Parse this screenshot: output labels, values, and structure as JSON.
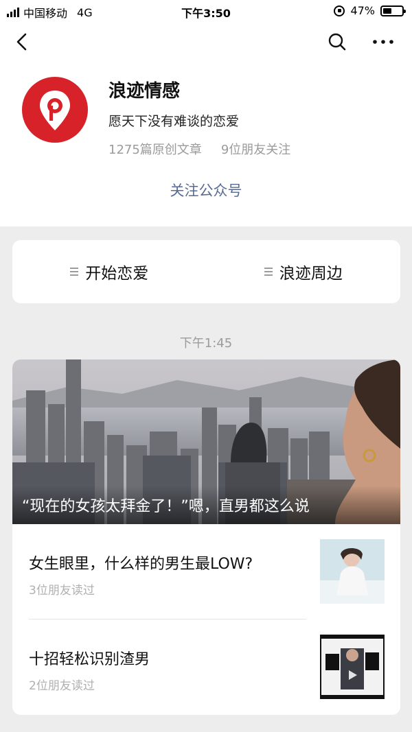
{
  "status_bar": {
    "carrier": "中国移动",
    "network": "4G",
    "time": "下午3:50",
    "battery_pct": "47%",
    "battery_level": 0.47
  },
  "nav": {
    "back_icon": "chevron-left-icon",
    "search_icon": "search-icon",
    "more_icon": "more-dots-icon"
  },
  "profile": {
    "name": "浪迹情感",
    "slogan": "愿天下没有难谈的恋爱",
    "articles": "1275篇原创文章",
    "friends_following": "9位朋友关注",
    "follow_label": "关注公众号",
    "brand_color": "#d8222a",
    "link_color": "#576b95"
  },
  "menu": {
    "items": [
      {
        "label": "开始恋爱"
      },
      {
        "label": "浪迹周边"
      }
    ]
  },
  "feed": {
    "timestamp": "下午1:45",
    "hero_title": "“现在的女孩太拜金了！”嗯，直男都这么说",
    "articles": [
      {
        "title": "女生眼里，什么样的男生最LOW?",
        "reads": "3位朋友读过"
      },
      {
        "title": "十招轻松识别渣男",
        "reads": "2位朋友读过"
      }
    ]
  }
}
